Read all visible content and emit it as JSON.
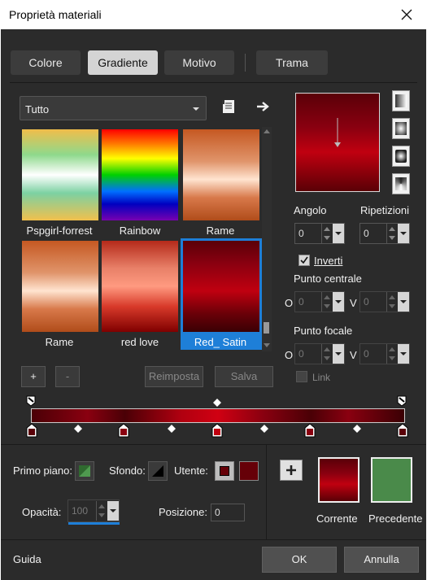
{
  "window": {
    "title": "Proprietà materiali"
  },
  "tabs": [
    {
      "label": "Colore",
      "active": false
    },
    {
      "label": "Gradiente",
      "active": true
    },
    {
      "label": "Motivo",
      "active": false
    },
    {
      "label": "Trama",
      "active": false
    }
  ],
  "gradient_library": {
    "category": "Tutto",
    "items": [
      {
        "name": "Pspgirl-forrest",
        "selected": false
      },
      {
        "name": "Rainbow",
        "selected": false
      },
      {
        "name": "Rame",
        "selected": false
      },
      {
        "name": "Rame",
        "selected": false
      },
      {
        "name": "red love",
        "selected": false
      },
      {
        "name": "Red_ Satin",
        "selected": true
      }
    ]
  },
  "library_buttons": {
    "add": "+",
    "remove": "-",
    "reset": "Reimposta",
    "save": "Salva"
  },
  "properties": {
    "angle_label": "Angolo",
    "angle_value": "0",
    "repeats_label": "Ripetizioni",
    "repeats_value": "0",
    "invert_label": "Inverti",
    "invert_checked": true,
    "center_label": "Punto centrale",
    "focal_label": "Punto focale",
    "h_label": "O",
    "v_label": "V",
    "center_h": "0",
    "center_v": "0",
    "focal_h": "0",
    "focal_v": "0",
    "link_label": "Link"
  },
  "editor": {
    "foreground_label": "Primo piano:",
    "background_label": "Sfondo:",
    "user_label": "Utente:",
    "opacity_label": "Opacità:",
    "opacity_value": "100",
    "position_label": "Posizione:",
    "position_value": "0"
  },
  "preview": {
    "current_label": "Corrente",
    "previous_label": "Precedente",
    "add_icon": "+"
  },
  "footer": {
    "help_label": "Guida",
    "ok_label": "OK",
    "cancel_label": "Annulla"
  },
  "colors": {
    "dialog_bg": "#2b2b2b",
    "selection_blue": "#1e7fd8",
    "deep_red": "#5a0000",
    "bright_red": "#c00010",
    "user_red": "#660008",
    "previous_green": "#4a8a4a",
    "foreground_green": "#4f9a4f"
  }
}
